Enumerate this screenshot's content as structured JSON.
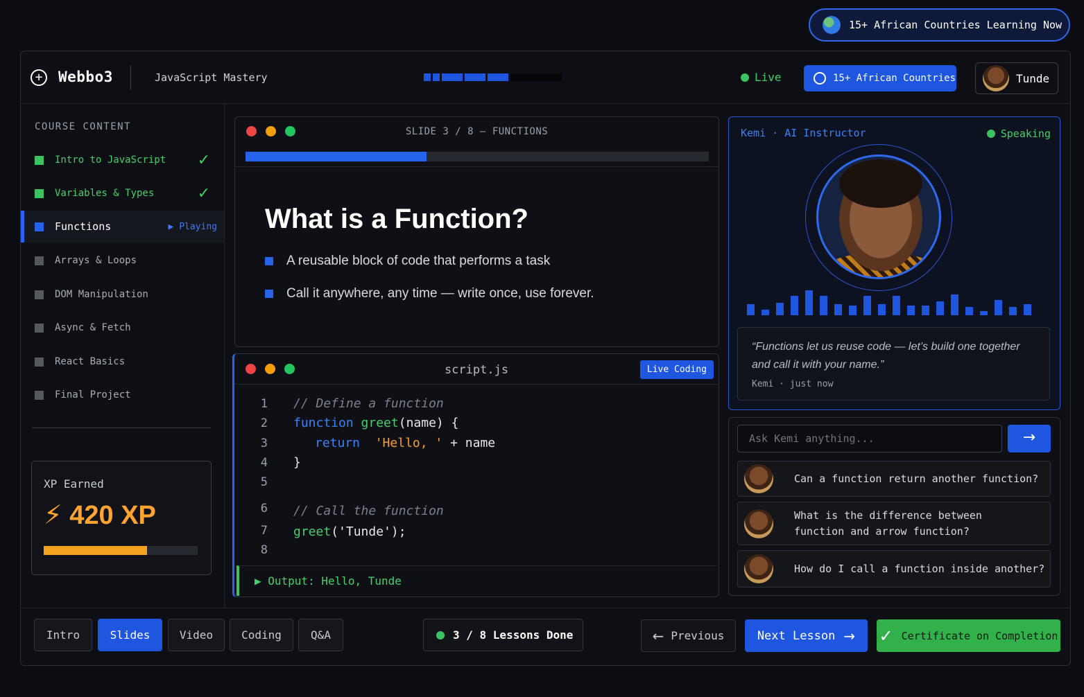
{
  "top_badge": {
    "label": "15+ African Countries Learning Now",
    "icon": "globe-icon"
  },
  "header": {
    "brand": "Webbo3",
    "course_title": "JavaScript Mastery",
    "live_label": "Live",
    "countries_label": "15+ African Countries",
    "user_name": "Tunde"
  },
  "sidebar": {
    "heading": "COURSE CONTENT",
    "lessons": [
      {
        "label": "Intro to JavaScript",
        "status": "done",
        "color": "#3cc360"
      },
      {
        "label": "Variables & Types",
        "status": "done",
        "color": "#3cc360"
      },
      {
        "label": "Functions",
        "status": "playing",
        "color": "#2563eb"
      },
      {
        "label": "Arrays & Loops",
        "status": "locked",
        "color": "#55585f"
      },
      {
        "label": "DOM Manipulation",
        "status": "locked",
        "color": "#55585f"
      },
      {
        "label": "Async & Fetch",
        "status": "locked",
        "color": "#55585f"
      },
      {
        "label": "React Basics",
        "status": "locked",
        "color": "#55585f"
      },
      {
        "label": "Final Project",
        "status": "locked",
        "color": "#55585f"
      }
    ],
    "playing_label": "▶ Playing",
    "xp": {
      "label": "XP Earned",
      "value": "420 XP",
      "progress": 0.67
    }
  },
  "slide": {
    "label": "SLIDE 3 / 8 — FUNCTIONS",
    "progress": 0.39,
    "title": "What is a Function?",
    "bullets": [
      "A reusable block of code that performs a task",
      "Call it anywhere, any time — write once, use forever."
    ]
  },
  "code": {
    "file_name": "script.js",
    "badge": "Live Coding",
    "line_numbers": [
      "1",
      "2",
      "3",
      "4",
      "5",
      "6",
      "7",
      "8"
    ],
    "lines": {
      "l1": "// Define a function",
      "l2_kw": "function",
      "l2_fn": "greet",
      "l2_rest": "(name) {",
      "l3_kw": "return",
      "l3_str": "'Hello, '",
      "l3_rest": " + name",
      "l4": "}",
      "l6": "// Call the function",
      "l7_fn": "greet",
      "l7_rest": "('Tunde');"
    },
    "output": "▶ Output: Hello, Tunde"
  },
  "instructor": {
    "name": "Kemi · AI Instructor",
    "status": "Speaking",
    "wave_levels": [
      0.4,
      0.2,
      0.45,
      0.7,
      0.9,
      0.7,
      0.4,
      0.35,
      0.7,
      0.4,
      0.7,
      0.35,
      0.35,
      0.5,
      0.75,
      0.3,
      0.15,
      0.55,
      0.3,
      0.4
    ],
    "quote": "“Functions let us reuse code — let’s build one together and call it with your name.”",
    "quote_meta": "Kemi · just now"
  },
  "ask": {
    "placeholder": "Ask Kemi anything...",
    "send_icon": "arrow-right-icon",
    "questions": [
      "Can a function return another function?",
      "What is the difference between function and arrow function?",
      "How do I call a function inside another?"
    ]
  },
  "footer": {
    "tabs": [
      "Intro",
      "Slides",
      "Video",
      "Coding",
      "Q&A"
    ],
    "active_tab": "Slides",
    "lessons_done": "3 / 8 Lessons Done",
    "prev_label": "Previous",
    "next_label": "Next Lesson",
    "cert_label": "Certificate on Completion"
  },
  "colors": {
    "accent": "#1e56e0",
    "success": "#3cc360",
    "xp": "#f4a21f"
  }
}
